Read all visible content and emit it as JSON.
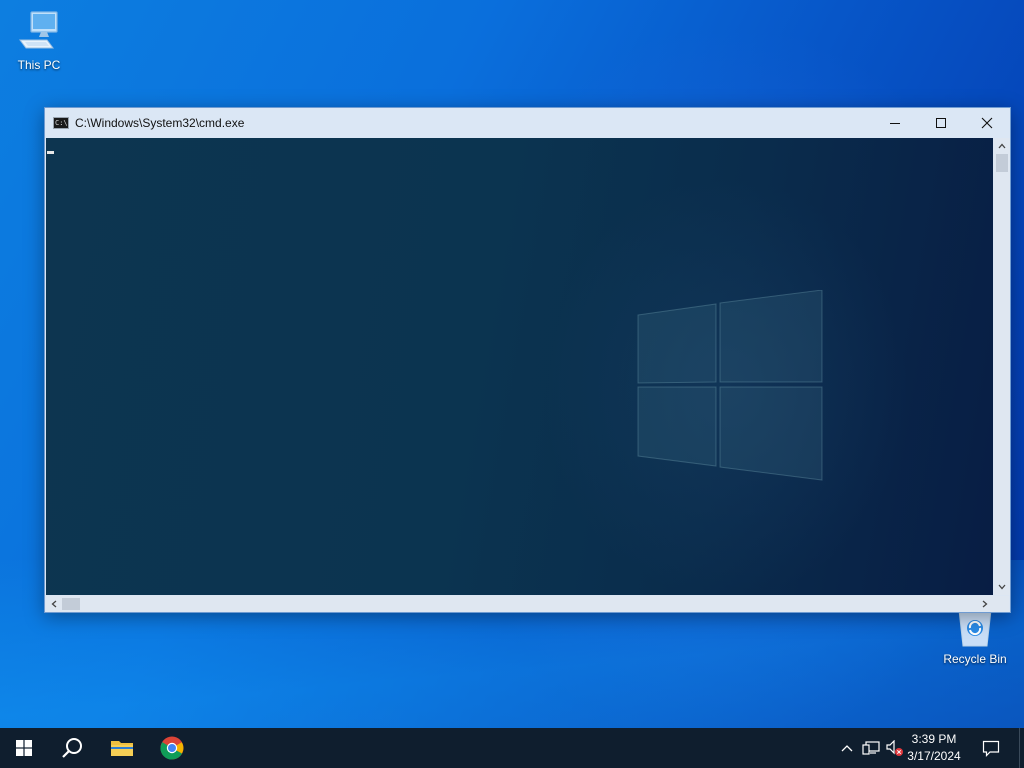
{
  "desktop": {
    "icons": [
      {
        "label": "This PC",
        "icon": "this-pc-icon"
      },
      {
        "label": "Recycle Bin",
        "icon": "recycle-bin-icon"
      }
    ],
    "accent": "#0a6fdc"
  },
  "window": {
    "title": "C:\\Windows\\System32\\cmd.exe",
    "app_icon": "console-app-icon",
    "app_icon_text": "C:\\",
    "buttons": {
      "minimize": "minimize-icon",
      "maximize": "maximize-icon",
      "close": "close-icon"
    },
    "console_background": "#0b3450"
  },
  "taskbar": {
    "items": [
      {
        "name": "start",
        "icon": "windows-logo-icon"
      },
      {
        "name": "search",
        "icon": "search-icon"
      },
      {
        "name": "file-explorer",
        "icon": "folder-icon"
      },
      {
        "name": "chrome",
        "icon": "chrome-icon"
      }
    ],
    "tray": {
      "icons": [
        "chevron-up-icon",
        "network-icon",
        "volume-muted-icon"
      ],
      "time": "3:39 PM",
      "date": "3/17/2024",
      "notification_icon": "notification-icon"
    },
    "background": "#0f1e2e"
  }
}
